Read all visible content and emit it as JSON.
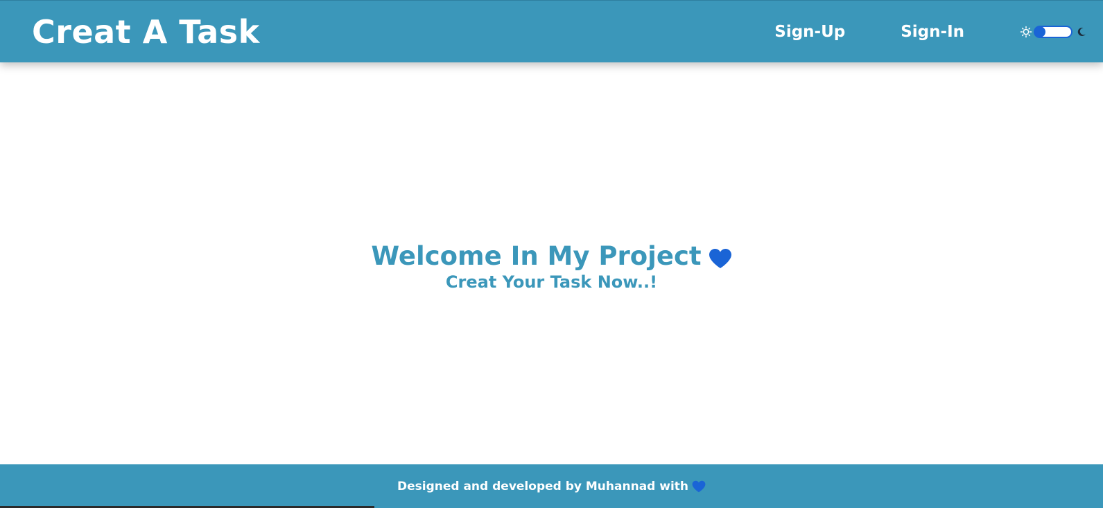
{
  "navbar": {
    "brand": "Creat A Task",
    "links": [
      {
        "label": "Sign-Up"
      },
      {
        "label": "Sign-In"
      }
    ],
    "theme_toggle": {
      "state": "light",
      "light_icon": "sun-icon",
      "dark_icon": "moon-icon"
    }
  },
  "main": {
    "title": "Welcome In My Project",
    "title_icon": "heart-icon",
    "subtitle": "Creat Your Task Now..!"
  },
  "footer": {
    "text": "Designed and developed by Muhannad with",
    "icon": "heart-icon"
  },
  "colors": {
    "primary": "#3b97ba",
    "accent": "#1a64d6",
    "background": "#ffffff",
    "text_on_primary": "#ffffff"
  }
}
